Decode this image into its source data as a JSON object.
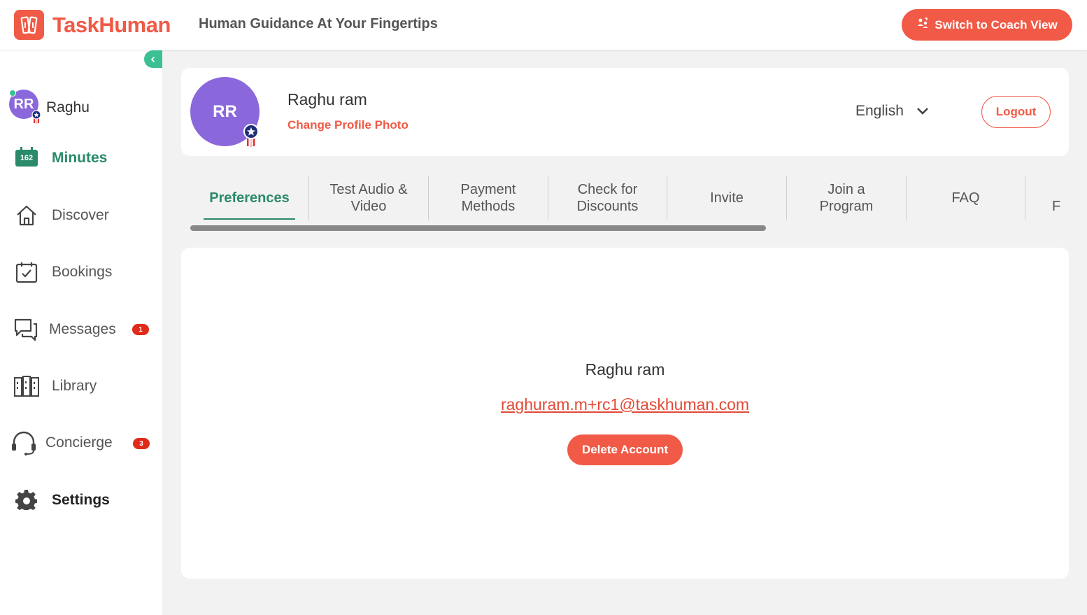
{
  "header": {
    "brand": "TaskHuman",
    "tagline": "Human Guidance At Your Fingertips",
    "coach_button": "Switch to Coach View"
  },
  "sidebar": {
    "user_initials": "RR",
    "user_name": "Raghu",
    "minutes_count": "162",
    "minutes_label": "Minutes",
    "items": [
      {
        "label": "Discover",
        "icon": "home-icon"
      },
      {
        "label": "Bookings",
        "icon": "calendar-check-icon"
      },
      {
        "label": "Messages",
        "icon": "chat-icon",
        "badge": "1"
      },
      {
        "label": "Library",
        "icon": "library-icon"
      },
      {
        "label": "Concierge",
        "icon": "headset-icon",
        "badge": "3"
      },
      {
        "label": "Settings",
        "icon": "gear-icon"
      }
    ]
  },
  "profile": {
    "initials": "RR",
    "name": "Raghu ram",
    "change_photo": "Change Profile Photo",
    "language": "English",
    "logout": "Logout"
  },
  "tabs": [
    {
      "label": "Preferences",
      "active": true
    },
    {
      "label": "Test Audio & Video"
    },
    {
      "label": "Payment Methods"
    },
    {
      "label": "Check for Discounts"
    },
    {
      "label": "Invite"
    },
    {
      "label": "Join a Program"
    },
    {
      "label": "FAQ"
    },
    {
      "label": "F"
    }
  ],
  "account": {
    "name": "Raghu ram",
    "email": "raghuram.m+rc1@taskhuman.com",
    "delete_button": "Delete Account"
  },
  "colors": {
    "brand": "#f05a46",
    "accent_green": "#2a8a6a",
    "avatar": "#8a68dc",
    "badge": "#e12a1a"
  }
}
